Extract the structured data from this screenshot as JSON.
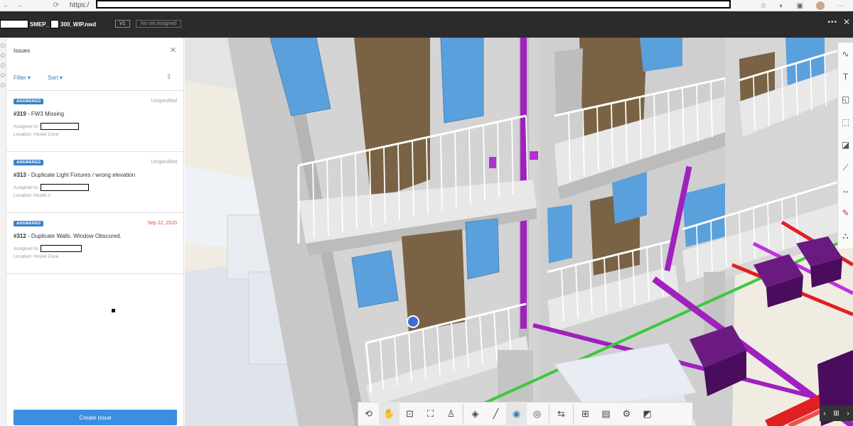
{
  "browser": {
    "url_prefix": "https:/"
  },
  "header": {
    "file_name_part1": "SMEP_",
    "file_name_part2": "300_WIP.nwd",
    "version": "V1",
    "set_status": "No set assigned"
  },
  "panel": {
    "title": "Issues",
    "filter_label": "Filter",
    "sort_label": "Sort",
    "create_button_label": "Create Issue"
  },
  "issues": [
    {
      "status": "ANSWERED",
      "date": "Unspecified",
      "overdue": false,
      "number": "#319",
      "title": " - FW3 Missing",
      "assigned_label": "Assigned to:",
      "location": "Location: Hostel Zone"
    },
    {
      "status": "ANSWERED",
      "date": "Unspecified",
      "overdue": false,
      "number": "#313",
      "title": " - Duplicate Light Fixtures / wrong elevation",
      "assigned_label": "Assigned to:",
      "location": "Location: Hostel 2"
    },
    {
      "status": "ANSWERED",
      "date": "Sep 22, 2020",
      "overdue": true,
      "number": "#312",
      "title": " - Duplicate Walls. Window Obscured.",
      "assigned_label": "Assigned to:",
      "location": "Location: Hostel Zone"
    }
  ],
  "colors": {
    "accent": "#3b8ee0",
    "badge": "#3b7fc7",
    "overdue": "#e0463a",
    "header_bg": "#2b2b2b",
    "pipe_magenta": "#a020c0",
    "pipe_green": "#3cc83c",
    "pipe_red": "#e02020"
  },
  "right_toolbar_icons": [
    "squiggle-icon",
    "text-icon",
    "callout-icon",
    "rectangle-icon",
    "area-icon",
    "measure-icon",
    "dimension-icon",
    "pencil-icon",
    "fill-icon"
  ],
  "bottom_toolbar_icons": [
    "orbit-icon",
    "pan-icon",
    "zoom-window-icon",
    "fit-icon",
    "first-person-icon",
    "section-icon",
    "measure-icon",
    "visibility-icon",
    "hide-icon",
    "sync-icon",
    "model-tree-icon",
    "properties-icon",
    "settings-icon",
    "fullscreen-icon"
  ]
}
